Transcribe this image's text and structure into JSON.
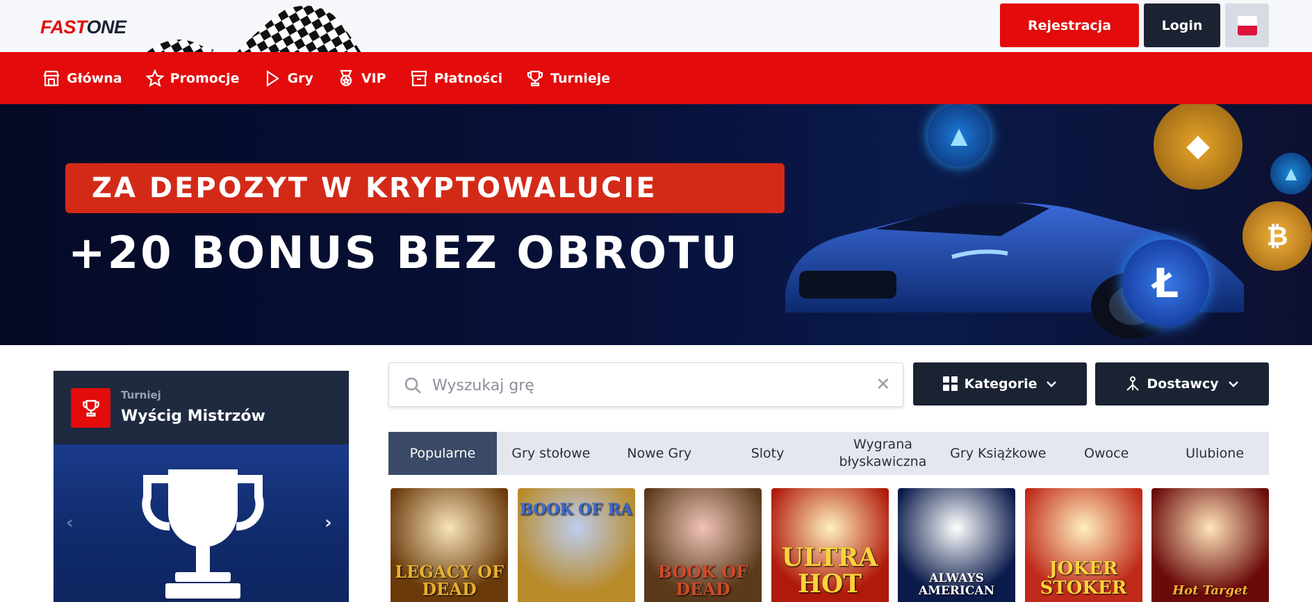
{
  "header": {
    "logo_part1": "FAST",
    "logo_part2": "ONE",
    "register_label": "Rejestracja",
    "login_label": "Login",
    "language_icon": "flag-pl-icon"
  },
  "nav": {
    "items": [
      {
        "label": "Główna",
        "icon": "home-icon"
      },
      {
        "label": "Promocje",
        "icon": "star-icon"
      },
      {
        "label": "Gry",
        "icon": "play-icon"
      },
      {
        "label": "VIP",
        "icon": "medal-icon"
      },
      {
        "label": "Płatności",
        "icon": "payment-icon"
      },
      {
        "label": "Turnieje",
        "icon": "trophy-icon"
      }
    ]
  },
  "hero": {
    "headline": "ZA DEPOZYT W KRYPTOWALUCIE",
    "subheadline": "+20 BONUS BEZ OBROTU"
  },
  "tournament": {
    "kicker": "Turniej",
    "title": "Wyścig Mistrzów"
  },
  "search": {
    "placeholder": "Wyszukaj grę"
  },
  "filters": {
    "categories_label": "Kategorie",
    "providers_label": "Dostawcy"
  },
  "tabs": [
    {
      "label": "Popularne",
      "active": true
    },
    {
      "label": "Gry stołowe",
      "active": false
    },
    {
      "label": "Nowe Gry",
      "active": false
    },
    {
      "label": "Sloty",
      "active": false
    },
    {
      "label": "Wygrana błyskawiczna",
      "active": false
    },
    {
      "label": "Gry Książkowe",
      "active": false
    },
    {
      "label": "Owoce",
      "active": false
    },
    {
      "label": "Ulubione",
      "active": false
    }
  ],
  "games": [
    {
      "title": "LEGACY OF DEAD",
      "bg": "#6b3a0a",
      "color": "#e8b030"
    },
    {
      "title": "BOOK OF RA",
      "bg": "#b88a2a",
      "color": "#3a6ad0"
    },
    {
      "title": "BOOK OF DEAD",
      "bg": "#5a3a1a",
      "color": "#d04a2a"
    },
    {
      "title": "ULTRA HOT",
      "bg": "#b01a0a",
      "color": "#ffd23a"
    },
    {
      "title": "ALWAYS AMERICAN",
      "bg": "#0a1a4a",
      "color": "#ffffff"
    },
    {
      "title": "JOKER STOKER",
      "bg": "#c02a1a",
      "color": "#ffd23a"
    },
    {
      "title": "Hot Target",
      "bg": "#6a0a0a",
      "color": "#ffb030"
    }
  ]
}
